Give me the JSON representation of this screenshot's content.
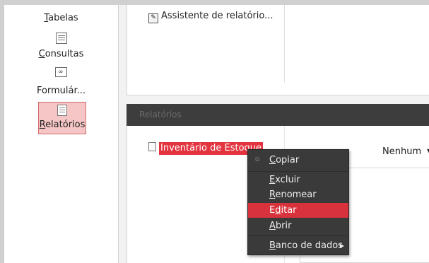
{
  "nav": {
    "tables": {
      "u": "T",
      "rest": "abelas"
    },
    "queries": {
      "u": "C",
      "rest": "onsultas"
    },
    "forms": {
      "label": "Formulár..."
    },
    "reports": {
      "u": "R",
      "rest": "elatórios"
    }
  },
  "tasks": {
    "wizard": "Assistente de relatório..."
  },
  "reports": {
    "header": "Relatórios",
    "item": "Inventário de Estoque",
    "preview_select": "Nenhum"
  },
  "context_menu": {
    "copy": {
      "u": "C",
      "rest": "opiar"
    },
    "delete": {
      "u": "E",
      "rest": "xcluir"
    },
    "rename": {
      "u": "R",
      "rest": "enomear"
    },
    "edit": {
      "pre": "E",
      "u": "d",
      "rest": "itar"
    },
    "open": {
      "u": "A",
      "rest": "brir"
    },
    "database": {
      "u": "B",
      "rest": "anco de dados"
    }
  },
  "colors": {
    "selection": "#e2333f",
    "menu_bg": "#3a3a3a",
    "menu_highlight": "#d8333c"
  }
}
